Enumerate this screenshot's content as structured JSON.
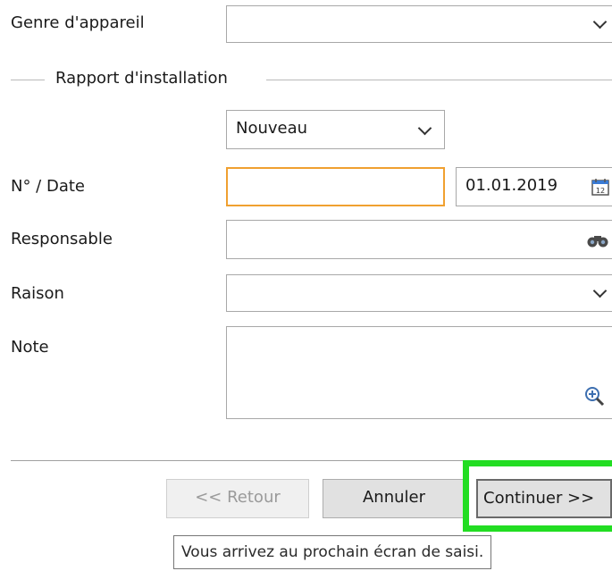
{
  "form": {
    "device_type": {
      "label": "Genre d'appareil",
      "value": ""
    },
    "report_group": {
      "title": "Rapport d'installation",
      "mode": "Nouveau"
    },
    "number_date": {
      "label": "N° / Date",
      "number": "",
      "date": "01.01.2019"
    },
    "responsible": {
      "label": "Responsable",
      "value": ""
    },
    "reason": {
      "label": "Raison",
      "value": ""
    },
    "note": {
      "label": "Note",
      "value": ""
    }
  },
  "buttons": {
    "back": "<< Retour",
    "cancel": "Annuler",
    "continue": "Continuer >>"
  },
  "tooltip": "Vous arrivez au prochain écran de saisi.",
  "colors": {
    "focus_border": "#f0a030",
    "highlight": "#22dd22",
    "disabled_text": "#9a9a9a"
  }
}
